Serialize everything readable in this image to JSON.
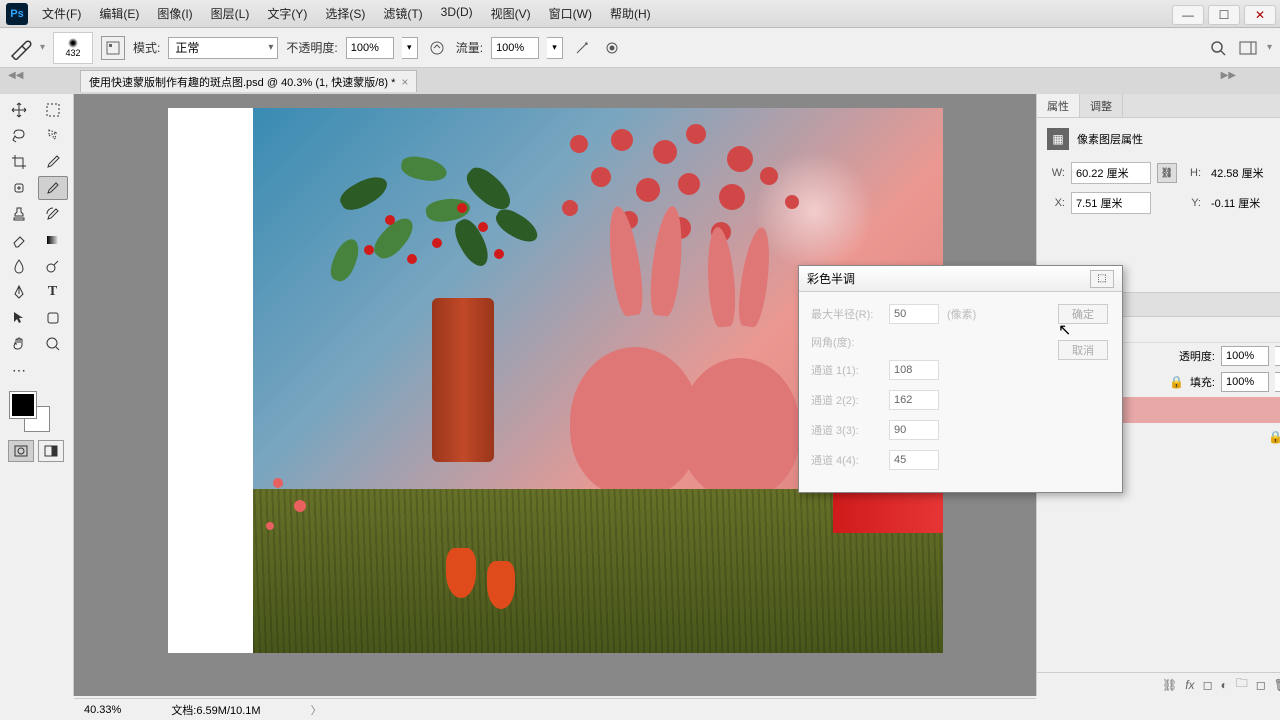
{
  "app": {
    "logo": "Ps"
  },
  "menu": [
    "文件(F)",
    "编辑(E)",
    "图像(I)",
    "图层(L)",
    "文字(Y)",
    "选择(S)",
    "滤镜(T)",
    "3D(D)",
    "视图(V)",
    "窗口(W)",
    "帮助(H)"
  ],
  "options": {
    "brush_size": "432",
    "mode_label": "模式:",
    "mode_value": "正常",
    "opacity_label": "不透明度:",
    "opacity_value": "100%",
    "flow_label": "流量:",
    "flow_value": "100%"
  },
  "tab": {
    "title": "使用快速蒙版制作有趣的斑点图.psd @ 40.3% (1, 快速蒙版/8) *"
  },
  "status": {
    "zoom": "40.33%",
    "doc": "文档:6.59M/10.1M"
  },
  "panels": {
    "properties_tab": "属性",
    "adjustments_tab": "调整",
    "prop_title": "像素图层属性",
    "w_label": "W:",
    "w_value": "60.22 厘米",
    "h_label": "H:",
    "h_value": "42.58 厘米",
    "x_label": "X:",
    "x_value": "7.51 厘米",
    "y_label": "Y:",
    "y_value": "-0.11 厘米",
    "opacity_label": "透明度:",
    "opacity_value": "100%",
    "fill_label": "填充:",
    "fill_value": "100%"
  },
  "dialog": {
    "title": "彩色半调",
    "max_radius_label": "最大半径(R):",
    "max_radius_value": "50",
    "max_radius_unit": "(像素)",
    "angle_label": "网角(度):",
    "ch1_label": "通道 1(1):",
    "ch1_value": "108",
    "ch2_label": "通道 2(2):",
    "ch2_value": "162",
    "ch3_label": "通道 3(3):",
    "ch3_value": "90",
    "ch4_label": "通道 4(4):",
    "ch4_value": "45",
    "ok": "确定",
    "cancel": "取消"
  }
}
